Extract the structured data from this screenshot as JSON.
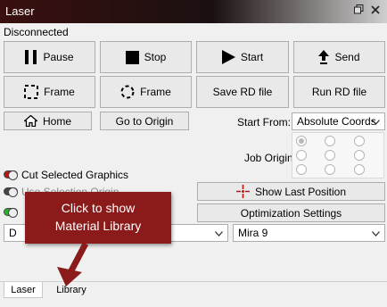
{
  "window": {
    "title": "Laser",
    "restore_icon": "restore-icon",
    "close_icon": "close-icon"
  },
  "status": {
    "text": "Disconnected"
  },
  "buttons": {
    "pause": "Pause",
    "stop": "Stop",
    "start": "Start",
    "send": "Send",
    "frame_square": "Frame",
    "frame_circle": "Frame",
    "save_rd": "Save RD file",
    "run_rd": "Run RD file",
    "home": "Home",
    "go_to_origin": "Go to Origin",
    "show_last_position": "Show Last Position",
    "optimization_settings": "Optimization Settings"
  },
  "start_from": {
    "label": "Start From:",
    "value": "Absolute Coords"
  },
  "job_origin": {
    "label": "Job Origin",
    "selected_index": 0
  },
  "options": {
    "cut_selected": "Cut Selected Graphics",
    "use_selection_origin": "Use Selection Origin"
  },
  "device_combo": {
    "value": "D"
  },
  "machine_combo": {
    "value": "Mira 9"
  },
  "callout": {
    "line1": "Click to show",
    "line2": "Material Library"
  },
  "tabs": [
    {
      "label": "Laser"
    },
    {
      "label": "Library"
    }
  ],
  "colors": {
    "callout": "#8b1a1a",
    "toggle_red": "#b01818",
    "toggle_green": "#29b32e"
  }
}
